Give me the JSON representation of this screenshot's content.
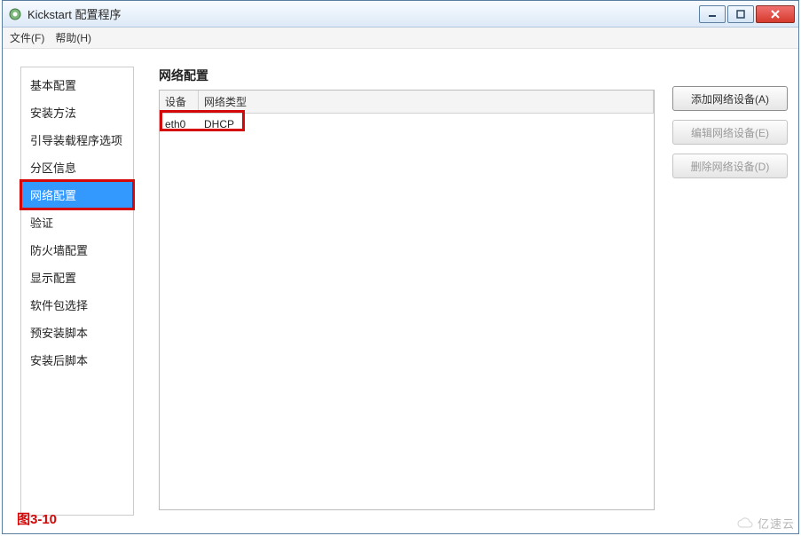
{
  "window": {
    "title": "Kickstart 配置程序"
  },
  "menubar": {
    "file": "文件(F)",
    "help": "帮助(H)"
  },
  "sidebar": {
    "items": [
      {
        "label": "基本配置"
      },
      {
        "label": "安装方法"
      },
      {
        "label": "引导装载程序选项"
      },
      {
        "label": "分区信息"
      },
      {
        "label": "网络配置",
        "selected": true,
        "highlight": true
      },
      {
        "label": "验证"
      },
      {
        "label": "防火墙配置"
      },
      {
        "label": "显示配置"
      },
      {
        "label": "软件包选择"
      },
      {
        "label": "预安装脚本"
      },
      {
        "label": "安装后脚本"
      }
    ]
  },
  "main": {
    "title": "网络配置",
    "table": {
      "headers": {
        "device": "设备",
        "type": "网络类型"
      },
      "rows": [
        {
          "device": "eth0",
          "type": "DHCP"
        }
      ]
    },
    "actions": {
      "add": "添加网络设备(A)",
      "edit": "编辑网络设备(E)",
      "delete": "删除网络设备(D)"
    }
  },
  "figure_label": "图3-10",
  "watermark": "亿速云"
}
